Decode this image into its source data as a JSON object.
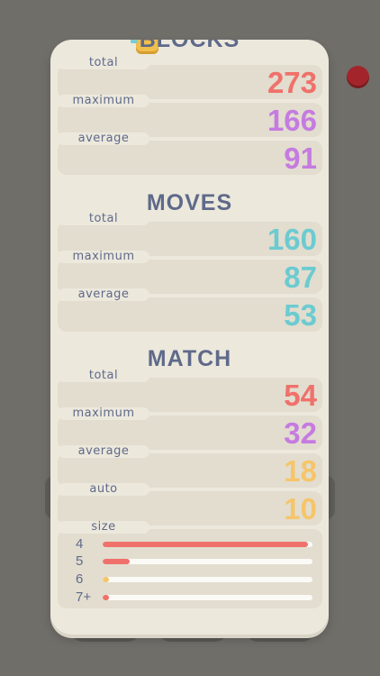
{
  "colors": {
    "red": "#f0716b",
    "purple": "#c57be0",
    "teal": "#6ccbd0",
    "orange": "#f6c56a",
    "title": "#5f6a8a",
    "red_dot": "#a3252b"
  },
  "blocks": {
    "title": "BLOCKS",
    "icon": "blocks-icon",
    "rows": [
      {
        "label": "total",
        "value": "273",
        "color": "#f0716b"
      },
      {
        "label": "maximum",
        "value": "166",
        "color": "#c57be0"
      },
      {
        "label": "average",
        "value": "91",
        "color": "#c57be0"
      }
    ]
  },
  "moves": {
    "title": "MOVES",
    "rows": [
      {
        "label": "total",
        "value": "160",
        "color": "#6ccbd0"
      },
      {
        "label": "maximum",
        "value": "87",
        "color": "#6ccbd0"
      },
      {
        "label": "average",
        "value": "53",
        "color": "#6ccbd0"
      }
    ]
  },
  "match": {
    "title": "MATCH",
    "rows": [
      {
        "label": "total",
        "value": "54",
        "color": "#f0716b"
      },
      {
        "label": "maximum",
        "value": "32",
        "color": "#c57be0"
      },
      {
        "label": "average",
        "value": "18",
        "color": "#f6c56a"
      },
      {
        "label": "auto",
        "value": "10",
        "color": "#f6c56a"
      }
    ],
    "size": {
      "label": "size",
      "bars": [
        {
          "label": "4",
          "fraction": 0.98,
          "color": "#f0716b"
        },
        {
          "label": "5",
          "fraction": 0.13,
          "color": "#f0716b"
        },
        {
          "label": "6",
          "fraction": 0.03,
          "color": "#f6c56a"
        },
        {
          "label": "7+",
          "fraction": 0.03,
          "color": "#f0716b"
        }
      ]
    }
  }
}
